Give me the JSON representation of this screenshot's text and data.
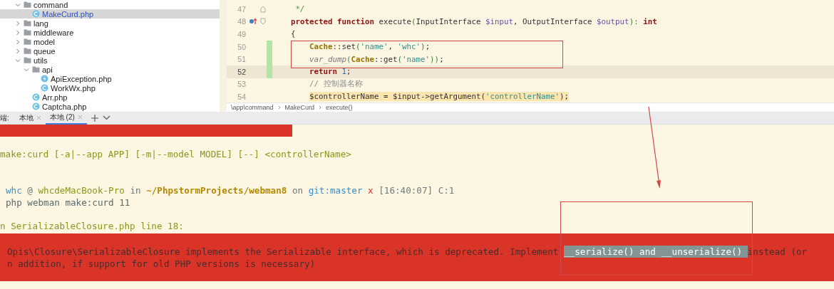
{
  "project_tree": [
    {
      "label": "command",
      "kind": "folder",
      "expanded": true,
      "selected": false,
      "children": [
        {
          "label": "MakeCurd.php",
          "kind": "class",
          "selected": true
        }
      ]
    },
    {
      "label": "lang",
      "kind": "folder",
      "expanded": false,
      "selected": false
    },
    {
      "label": "middleware",
      "kind": "folder",
      "expanded": false,
      "selected": false
    },
    {
      "label": "model",
      "kind": "folder",
      "expanded": false,
      "selected": false
    },
    {
      "label": "queue",
      "kind": "folder",
      "expanded": false,
      "selected": false
    },
    {
      "label": "utils",
      "kind": "folder",
      "expanded": true,
      "selected": false,
      "children": [
        {
          "label": "api",
          "kind": "folder",
          "expanded": true,
          "selected": false,
          "children": [
            {
              "label": "ApiException.php",
              "kind": "exception",
              "selected": false
            },
            {
              "label": "WorkWx.php",
              "kind": "class",
              "selected": false
            }
          ]
        },
        {
          "label": "Arr.php",
          "kind": "class",
          "selected": false
        },
        {
          "label": "Captcha.php",
          "kind": "class",
          "selected": false
        }
      ]
    }
  ],
  "editor": {
    "lines": [
      {
        "number": "47",
        "current": false,
        "changed": false,
        "highlighted": false,
        "tokens": [
          {
            "kind": "doc",
            "text": "     */"
          }
        ]
      },
      {
        "number": "48",
        "current": false,
        "changed": false,
        "highlighted": false,
        "tokens": [
          {
            "kind": "kw",
            "text": "    protected function "
          },
          {
            "kind": "plain",
            "text": "execute"
          },
          {
            "kind": "punct",
            "text": "("
          },
          {
            "kind": "plain",
            "text": "InputInterface "
          },
          {
            "kind": "var",
            "text": "$input"
          },
          {
            "kind": "plain",
            "text": ", OutputInterface "
          },
          {
            "kind": "var",
            "text": "$output"
          },
          {
            "kind": "punct",
            "text": "): "
          },
          {
            "kind": "kw",
            "text": "int"
          }
        ]
      },
      {
        "number": "49",
        "current": false,
        "changed": false,
        "highlighted": false,
        "tokens": [
          {
            "kind": "plain",
            "text": "    {"
          }
        ]
      },
      {
        "number": "50",
        "current": false,
        "changed": true,
        "highlighted": false,
        "tokens": [
          {
            "kind": "cls",
            "text": "        Cache"
          },
          {
            "kind": "plain",
            "text": "::set"
          },
          {
            "kind": "punct",
            "text": "("
          },
          {
            "kind": "str",
            "text": "'name'"
          },
          {
            "kind": "plain",
            "text": ", "
          },
          {
            "kind": "str",
            "text": "'whc'"
          },
          {
            "kind": "punct",
            "text": ")"
          },
          {
            "kind": "plain",
            "text": ";"
          }
        ]
      },
      {
        "number": "51",
        "current": false,
        "changed": true,
        "highlighted": false,
        "tokens": [
          {
            "kind": "fn",
            "text": "        var_dump"
          },
          {
            "kind": "punct",
            "text": "("
          },
          {
            "kind": "cls",
            "text": "Cache"
          },
          {
            "kind": "plain",
            "text": "::get"
          },
          {
            "kind": "punct",
            "text": "("
          },
          {
            "kind": "str",
            "text": "'name'"
          },
          {
            "kind": "punct",
            "text": "))"
          },
          {
            "kind": "plain",
            "text": ";"
          }
        ]
      },
      {
        "number": "52",
        "current": true,
        "changed": true,
        "highlighted": false,
        "tokens": [
          {
            "kind": "kw",
            "text": "        return "
          },
          {
            "kind": "num",
            "text": "1"
          },
          {
            "kind": "plain",
            "text": ";"
          }
        ]
      },
      {
        "number": "53",
        "current": false,
        "changed": false,
        "highlighted": false,
        "tokens": [
          {
            "kind": "comment",
            "text": "        // 控制器名称"
          }
        ]
      },
      {
        "number": "54",
        "current": false,
        "changed": false,
        "highlighted": true,
        "tokens": [
          {
            "kind": "var2",
            "text": "        $controllerName = $input->getArgument("
          },
          {
            "kind": "str",
            "text": "'controllerName'"
          },
          {
            "kind": "var2",
            "text": ");"
          }
        ]
      }
    ],
    "breadcrumbs": [
      "\\app\\command",
      "MakeCurd",
      "execute()"
    ]
  },
  "terminal": {
    "label": "端:",
    "tabs": [
      {
        "label": "本地",
        "selected": false
      },
      {
        "label": "本地 (2)",
        "selected": true
      }
    ],
    "lines": [
      {
        "kind": "usage",
        "segments": [
          {
            "kind": "usage",
            "text": "make:curd [-a|--app APP] [-m|--model MODEL] [--] <controllerName>"
          }
        ]
      },
      {
        "kind": "prompt",
        "segments": [
          {
            "kind": "user",
            "text": "whc"
          },
          {
            "kind": "dim",
            "text": " @ "
          },
          {
            "kind": "host",
            "text": "whcdeMacBook-Pro"
          },
          {
            "kind": "dim",
            "text": " in "
          },
          {
            "kind": "path",
            "text": "~/PhpstormProjects/webman8"
          },
          {
            "kind": "dim",
            "text": " on "
          },
          {
            "kind": "git",
            "text": "git:master"
          },
          {
            "kind": "dirty",
            "text": " x"
          },
          {
            "kind": "dim",
            "text": " [16:40:07] C:1"
          }
        ]
      },
      {
        "kind": "command",
        "segments": [
          {
            "kind": "plain",
            "text": "php webman make:curd 11"
          }
        ]
      },
      {
        "kind": "location",
        "segments": [
          {
            "kind": "usage",
            "text": "n SerializableClosure.php line 18:"
          }
        ]
      },
      {
        "kind": "error",
        "segments": [
          {
            "kind": "error",
            "text": "Opis\\Closure\\SerializableClosure implements the Serializable interface, which is deprecated. Implement "
          },
          {
            "kind": "selection",
            "text": "__serialize() and __unserialize() "
          },
          {
            "kind": "error",
            "text": "instead (or"
          }
        ]
      },
      {
        "kind": "error",
        "segments": [
          {
            "kind": "error",
            "text": "n addition, if support for old PHP versions is necessary)"
          }
        ]
      }
    ]
  }
}
